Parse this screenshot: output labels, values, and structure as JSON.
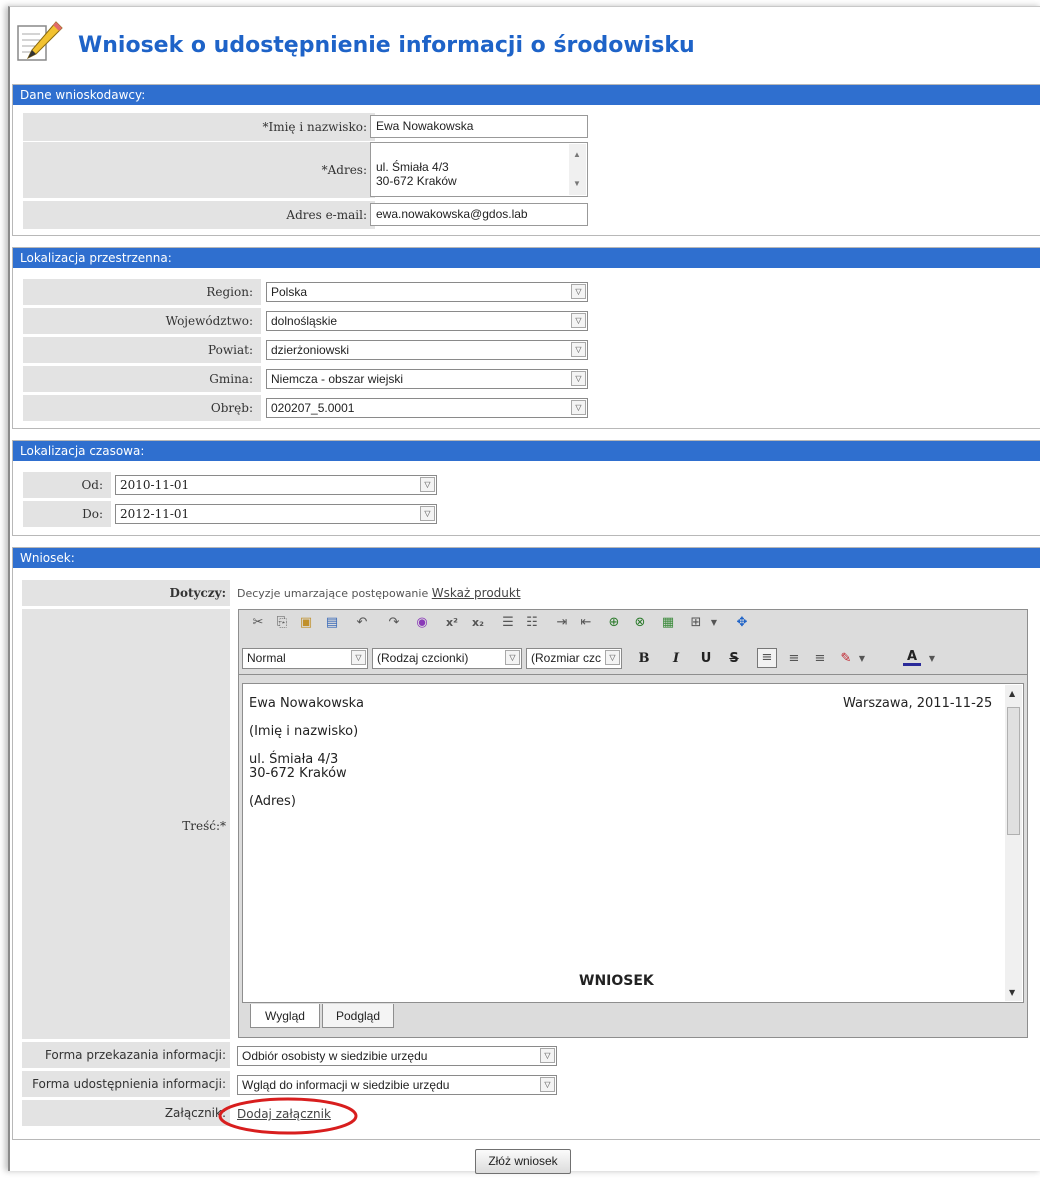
{
  "page_title": "Wniosek o udostępnienie informacji o środowisku",
  "sections": {
    "applicant": {
      "header": "Dane wnioskodawcy:",
      "name_label": "*Imię i nazwisko:",
      "name_value": "Ewa Nowakowska",
      "address_label": "*Adres:",
      "address_value": "ul. Śmiała 4/3\n30-672 Kraków",
      "email_label": "Adres e-mail:",
      "email_value": "ewa.nowakowska@gdos.lab"
    },
    "spatial": {
      "header": "Lokalizacja przestrzenna:",
      "region_label": "Region:",
      "region_value": "Polska",
      "voivodeship_label": "Województwo:",
      "voivodeship_value": "dolnośląskie",
      "county_label": "Powiat:",
      "county_value": "dzierżoniowski",
      "commune_label": "Gmina:",
      "commune_value": "Niemcza - obszar wiejski",
      "precinct_label": "Obręb:",
      "precinct_value": "020207_5.0001"
    },
    "temporal": {
      "header": "Lokalizacja czasowa:",
      "from_label": "Od:",
      "from_value": "2010-11-01",
      "to_label": "Do:",
      "to_value": "2012-11-01"
    },
    "request": {
      "header": "Wniosek:",
      "concerns_label": "Dotyczy:",
      "concerns_value": "Decyzje umarzające postępowanie",
      "show_product_link": "Wskaż produkt",
      "content_label": "Treść:*",
      "toolbar": {
        "format_value": "Normal",
        "font_value": "(Rodzaj czcionki)",
        "size_value": "(Rozmiar czc",
        "bold": "B",
        "italic": "I",
        "underline": "U",
        "strike": "S",
        "font_color": "A"
      },
      "editor": {
        "name": "Ewa Nowakowska",
        "place_date": "Warszawa, 2011-11-25",
        "name_caption": "(Imię i nazwisko)",
        "address_line1": "ul. Śmiała 4/3",
        "address_line2": "30-672 Kraków",
        "address_caption": "(Adres)",
        "heading": "WNIOSEK"
      },
      "tab_design": "Wygląd",
      "tab_preview": "Podgląd",
      "delivery_label": "Forma przekazania informacji:",
      "delivery_value": "Odbiór osobisty w siedzibie urzędu",
      "access_label": "Forma udostępnienia informacji:",
      "access_value": "Wgląd do informacji w siedzibie urzędu",
      "attachment_label": "Załącznik:",
      "attachment_link": "Dodaj załącznik"
    }
  },
  "submit_button": "Złóż wniosek",
  "colors": {
    "section_header": "#2f6fcf",
    "title": "#1e63c8",
    "label_bg": "#e3e3e3",
    "highlight_circle": "#d81e1e"
  }
}
